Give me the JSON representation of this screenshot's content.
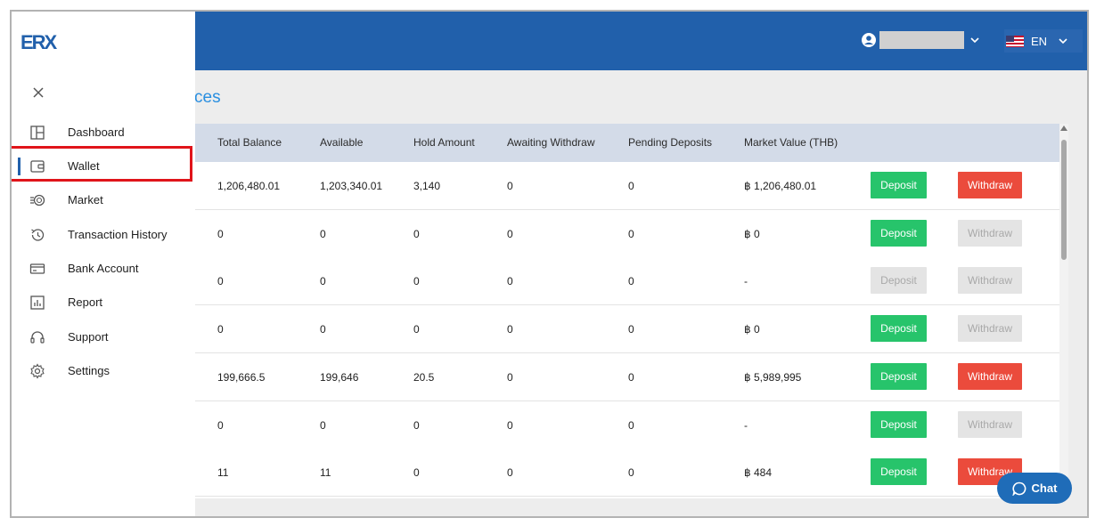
{
  "header": {
    "language": "EN"
  },
  "page": {
    "title_fragment": "ces"
  },
  "sidebar": {
    "logo_text": "ERX",
    "items": [
      {
        "label": "Dashboard",
        "icon": "dashboard-icon"
      },
      {
        "label": "Wallet",
        "icon": "wallet-icon",
        "active": true
      },
      {
        "label": "Market",
        "icon": "market-icon"
      },
      {
        "label": "Transaction History",
        "icon": "history-icon"
      },
      {
        "label": "Bank Account",
        "icon": "bank-card-icon"
      },
      {
        "label": "Report",
        "icon": "report-icon"
      },
      {
        "label": "Support",
        "icon": "headset-icon"
      },
      {
        "label": "Settings",
        "icon": "gear-icon"
      }
    ]
  },
  "table": {
    "columns": [
      "Total Balance",
      "Available",
      "Hold Amount",
      "Awaiting Withdraw",
      "Pending Deposits",
      "Market Value (THB)"
    ],
    "deposit_label": "Deposit",
    "withdraw_label": "Withdraw",
    "rows": [
      {
        "total": "1,206,480.01",
        "available": "1,203,340.01",
        "hold": "3,140",
        "awaiting": "0",
        "pending": "0",
        "market": "฿ 1,206,480.01",
        "deposit_enabled": true,
        "withdraw_enabled": true
      },
      {
        "total": "0",
        "available": "0",
        "hold": "0",
        "awaiting": "0",
        "pending": "0",
        "market": "฿ 0",
        "deposit_enabled": true,
        "withdraw_enabled": false
      },
      {
        "total": "0",
        "available": "0",
        "hold": "0",
        "awaiting": "0",
        "pending": "0",
        "market": "-",
        "deposit_enabled": false,
        "withdraw_enabled": false
      },
      {
        "total": "0",
        "available": "0",
        "hold": "0",
        "awaiting": "0",
        "pending": "0",
        "market": "฿ 0",
        "deposit_enabled": true,
        "withdraw_enabled": false
      },
      {
        "total": "199,666.5",
        "available": "199,646",
        "hold": "20.5",
        "awaiting": "0",
        "pending": "0",
        "market": "฿ 5,989,995",
        "deposit_enabled": true,
        "withdraw_enabled": true
      },
      {
        "total": "0",
        "available": "0",
        "hold": "0",
        "awaiting": "0",
        "pending": "0",
        "market": "-",
        "deposit_enabled": true,
        "withdraw_enabled": false
      },
      {
        "total": "11",
        "available": "11",
        "hold": "0",
        "awaiting": "0",
        "pending": "0",
        "market": "฿ 484",
        "deposit_enabled": true,
        "withdraw_enabled": true
      }
    ]
  },
  "chat": {
    "label": "Chat"
  },
  "colors": {
    "header_blue": "#2160ab",
    "deposit_green": "#27c46b",
    "withdraw_red": "#eb4b3c",
    "disabled_gray": "#e4e4e4",
    "highlight_red": "#e0141a"
  }
}
